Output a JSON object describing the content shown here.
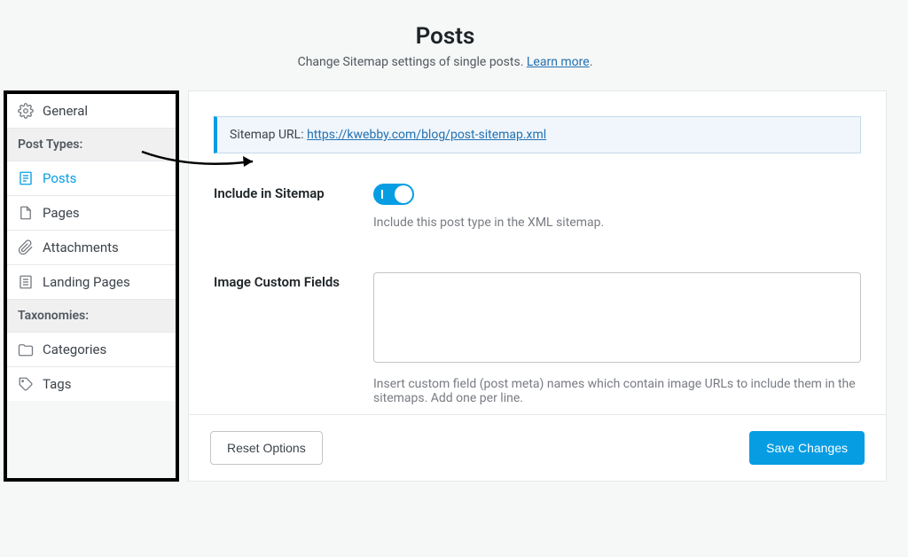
{
  "header": {
    "title": "Posts",
    "subtitle_prefix": "Change Sitemap settings of single posts. ",
    "learn_more": "Learn more",
    "subtitle_suffix": "."
  },
  "sidebar": {
    "general": "General",
    "section_post_types": "Post Types:",
    "posts": "Posts",
    "pages": "Pages",
    "attachments": "Attachments",
    "landing_pages": "Landing Pages",
    "section_taxonomies": "Taxonomies:",
    "categories": "Categories",
    "tags": "Tags"
  },
  "notice": {
    "label": "Sitemap URL: ",
    "url": "https://kwebby.com/blog/post-sitemap.xml"
  },
  "include": {
    "label": "Include in Sitemap",
    "help": "Include this post type in the XML sitemap."
  },
  "image_fields": {
    "label": "Image Custom Fields",
    "help": "Insert custom field (post meta) names which contain image URLs to include them in the sitemaps. Add one per line."
  },
  "footer": {
    "reset": "Reset Options",
    "save": "Save Changes"
  }
}
